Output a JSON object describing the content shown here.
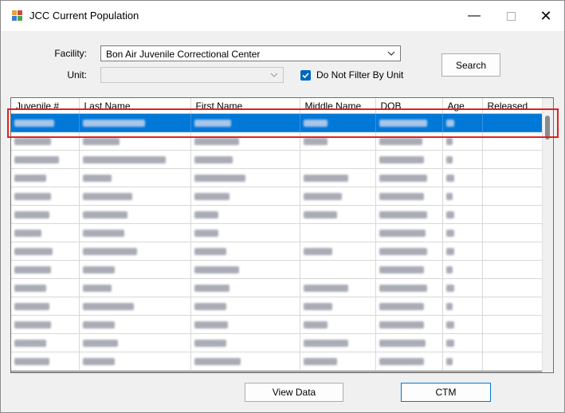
{
  "window": {
    "title": "JCC Current Population"
  },
  "filters": {
    "facility_label": "Facility:",
    "facility_value": "Bon Air Juvenile Correctional Center",
    "unit_label": "Unit:",
    "unit_value": "",
    "do_not_filter_label": "Do Not Filter By Unit",
    "do_not_filter_checked": true
  },
  "buttons": {
    "search": "Search",
    "view_data": "View Data",
    "ctm": "CTM"
  },
  "grid": {
    "columns": [
      "Juvenile #",
      "Last Name",
      "First Name",
      "Middle Name",
      "DOB",
      "Age",
      "Released"
    ],
    "selected_row": 0,
    "row_count_visible": 14,
    "cell_contents": "redacted (blurred)"
  },
  "colors": {
    "selection": "#0078d7",
    "highlight_box": "#e02020",
    "checkbox": "#0067c0"
  }
}
